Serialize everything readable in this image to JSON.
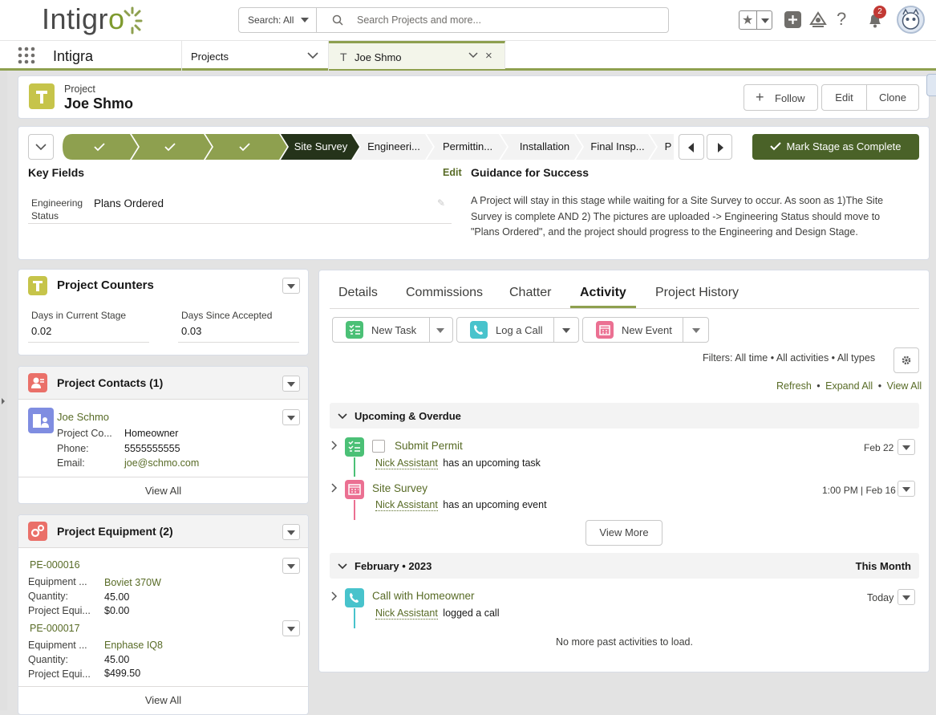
{
  "header": {
    "logo_text": "Intigr",
    "logo_o": "o",
    "search_scope": "Search: All",
    "search_placeholder": "Search Projects and more...",
    "notification_count": "2"
  },
  "nav": {
    "app_name": "Intigra",
    "tabs": [
      {
        "label": "Projects"
      },
      {
        "label": "Joe Shmo"
      }
    ]
  },
  "record": {
    "type": "Project",
    "name": "Joe Shmo",
    "buttons": {
      "follow": "Follow",
      "edit": "Edit",
      "clone": "Clone"
    }
  },
  "path": {
    "stages": [
      {
        "label": "",
        "state": "done"
      },
      {
        "label": "",
        "state": "done"
      },
      {
        "label": "",
        "state": "done"
      },
      {
        "label": "Site Survey",
        "state": "current"
      },
      {
        "label": "Engineeri...",
        "state": "todo"
      },
      {
        "label": "Permittin...",
        "state": "todo"
      },
      {
        "label": "Installation",
        "state": "todo"
      },
      {
        "label": "Final Insp...",
        "state": "todo"
      },
      {
        "label": "P",
        "state": "todo"
      }
    ],
    "mark_complete": "Mark Stage as Complete",
    "key_fields_title": "Key Fields",
    "edit_link": "Edit",
    "engineering_status_label_1": "Engineering",
    "engineering_status_label_2": "Status",
    "engineering_status_value": "Plans Ordered",
    "guidance_title": "Guidance for Success",
    "guidance_lines": [
      "A Project will stay in this stage while waiting for a Site Survey to occur. As soon as 1)The Site",
      "Survey is complete AND 2) The pictures are uploaded -> Engineering Status should move to",
      "\"Plans Ordered\", and the project should progress to the Engineering and Design Stage."
    ]
  },
  "counters": {
    "title": "Project Counters",
    "days_current_label": "Days in Current Stage",
    "days_current_value": "0.02",
    "days_accepted_label": "Days Since Accepted",
    "days_accepted_value": "0.03"
  },
  "contacts": {
    "title": "Project Contacts (1)",
    "name": "Joe Schmo",
    "rows": [
      {
        "label": "Project Co...",
        "value": "Homeowner"
      },
      {
        "label": "Phone:",
        "value": "5555555555"
      },
      {
        "label": "Email:",
        "value": "joe@schmo.com"
      }
    ],
    "view_all": "View All"
  },
  "equipment": {
    "title": "Project Equipment (2)",
    "items": [
      {
        "id": "PE-000016",
        "equipment_label": "Equipment ...",
        "equipment_value": "Boviet 370W",
        "qty_label": "Quantity:",
        "qty_value": "45.00",
        "price_label": "Project Equi...",
        "price_value": "$0.00"
      },
      {
        "id": "PE-000017",
        "equipment_label": "Equipment ...",
        "equipment_value": "Enphase IQ8",
        "qty_label": "Quantity:",
        "qty_value": "45.00",
        "price_label": "Project Equi...",
        "price_value": "$499.50"
      }
    ],
    "view_all": "View All"
  },
  "activity": {
    "tabs": [
      "Details",
      "Commissions",
      "Chatter",
      "Activity",
      "Project History"
    ],
    "active_tab": "Activity",
    "actions": {
      "new_task": "New Task",
      "log_call": "Log a Call",
      "new_event": "New Event"
    },
    "filters": "Filters: All time • All activities • All types",
    "refresh": "Refresh",
    "expand_all": "Expand All",
    "view_all": "View All",
    "sep": "•",
    "upcoming_title": "Upcoming & Overdue",
    "upcoming": [
      {
        "title": "Submit Permit",
        "date": "Feb 22",
        "owner": "Nick Assistant",
        "desc": "has an upcoming task",
        "kind": "task"
      },
      {
        "title": "Site Survey",
        "date": "1:00 PM | Feb 16",
        "owner": "Nick Assistant",
        "desc": "has an upcoming event",
        "kind": "event"
      }
    ],
    "view_more": "View More",
    "month_title": "February • 2023",
    "month_label": "This Month",
    "past": [
      {
        "title": "Call with Homeowner",
        "date": "Today",
        "owner": "Nick Assistant",
        "desc": "logged a call",
        "kind": "call"
      }
    ],
    "no_more": "No more past activities to load."
  },
  "colors": {
    "brand": "#8ea04f",
    "current_stage": "#25331a",
    "mark_button": "#4a6228",
    "task_icon": "#4bc076",
    "event_icon": "#eb7092",
    "call_icon": "#48c3cc"
  }
}
